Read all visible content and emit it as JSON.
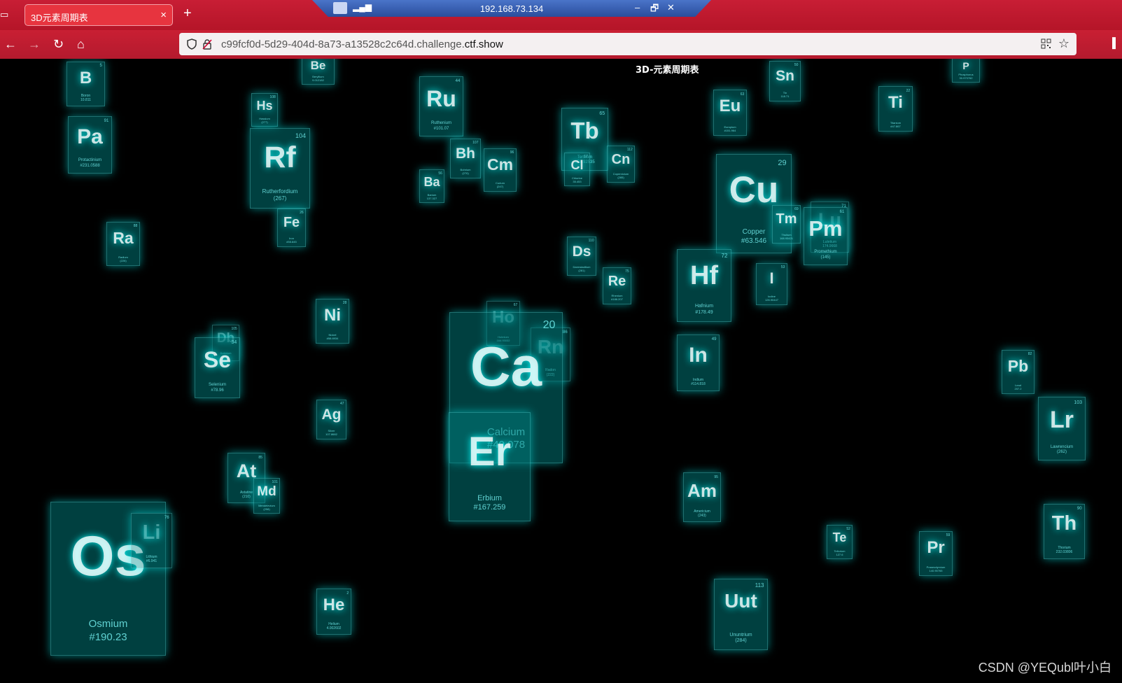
{
  "browser": {
    "tab_title": "3D元素周期表",
    "tab_close": "×",
    "new_tab": "+",
    "remote_title": "192.168.73.134",
    "remote_minimize": "–",
    "remote_restore": "🗗",
    "remote_close": "✕",
    "nav_back": "←",
    "nav_forward": "→",
    "nav_reload": "↻",
    "nav_home": "⌂",
    "url_prefix": "c99fcf0d-5d29-404d-8a73-a13528c2c64d.challenge.",
    "url_domain": "ctf.show",
    "star": "☆"
  },
  "page": {
    "title": "3D-元素周期表"
  },
  "elements": [
    {
      "id": "b",
      "symbol": "B",
      "number": "5",
      "name": "Boron",
      "weight": "10.811"
    },
    {
      "id": "be",
      "symbol": "Be",
      "number": "",
      "name": "Beryllium",
      "weight": "9.012182"
    },
    {
      "id": "p",
      "symbol": "P",
      "number": "",
      "name": "Phosphorus",
      "weight": "30.973762"
    },
    {
      "id": "hs",
      "symbol": "Hs",
      "number": "108",
      "name": "Hassium",
      "weight": "(277)"
    },
    {
      "id": "pa",
      "symbol": "Pa",
      "number": "91",
      "name": "Protactinium",
      "weight": "#231.0588"
    },
    {
      "id": "rf",
      "symbol": "Rf",
      "number": "104",
      "name": "Rutherfordium",
      "weight": "(267)"
    },
    {
      "id": "ru",
      "symbol": "Ru",
      "number": "44",
      "name": "Ruthenium",
      "weight": "#101.07"
    },
    {
      "id": "bh",
      "symbol": "Bh",
      "number": "107",
      "name": "Bohrium",
      "weight": "(270)"
    },
    {
      "id": "cm",
      "symbol": "Cm",
      "number": "96",
      "name": "Curium",
      "weight": "(247)"
    },
    {
      "id": "ba",
      "symbol": "Ba",
      "number": "56",
      "name": "Barium",
      "weight": "137.327"
    },
    {
      "id": "tb",
      "symbol": "Tb",
      "number": "65",
      "name": "Terbium",
      "weight": "158.92535"
    },
    {
      "id": "cl",
      "symbol": "Cl",
      "number": "17",
      "name": "Chlorine",
      "weight": "35.453"
    },
    {
      "id": "cn",
      "symbol": "Cn",
      "number": "112",
      "name": "Copernicium",
      "weight": "(285)"
    },
    {
      "id": "eu",
      "symbol": "Eu",
      "number": "63",
      "name": "Europium",
      "weight": "#151.964"
    },
    {
      "id": "sn",
      "symbol": "Sn",
      "number": "50",
      "name": "Tin",
      "weight": "118.71"
    },
    {
      "id": "ti",
      "symbol": "Ti",
      "number": "22",
      "name": "Titanium",
      "weight": "#47.867"
    },
    {
      "id": "fe",
      "symbol": "Fe",
      "number": "26",
      "name": "Iron",
      "weight": "#55.845"
    },
    {
      "id": "ra",
      "symbol": "Ra",
      "number": "88",
      "name": "Radium",
      "weight": "(226)"
    },
    {
      "id": "cu",
      "symbol": "Cu",
      "number": "29",
      "name": "Copper",
      "weight": "#63.546"
    },
    {
      "id": "lu",
      "symbol": "Lu",
      "number": "71",
      "name": "Lutetium",
      "weight": "174.9668"
    },
    {
      "id": "tm",
      "symbol": "Tm",
      "number": "69",
      "name": "Thulium",
      "weight": "168.93421"
    },
    {
      "id": "pm",
      "symbol": "Pm",
      "number": "61",
      "name": "Promethium",
      "weight": "(145)"
    },
    {
      "id": "ds",
      "symbol": "Ds",
      "number": "110",
      "name": "Darmstadtium",
      "weight": "(281)"
    },
    {
      "id": "re",
      "symbol": "Re",
      "number": "75",
      "name": "Rhenium",
      "weight": "#186.207"
    },
    {
      "id": "hf",
      "symbol": "Hf",
      "number": "72",
      "name": "Hafnium",
      "weight": "#178.49"
    },
    {
      "id": "i",
      "symbol": "I",
      "number": "53",
      "name": "Iodine",
      "weight": "126.90447"
    },
    {
      "id": "ni",
      "symbol": "Ni",
      "number": "28",
      "name": "Nickel",
      "weight": "#58.6934"
    },
    {
      "id": "db",
      "symbol": "Db",
      "number": "105",
      "name": "Dubnium",
      "weight": "(268)"
    },
    {
      "id": "se",
      "symbol": "Se",
      "number": "34",
      "name": "Selenium",
      "weight": "#78.96"
    },
    {
      "id": "ho",
      "symbol": "Ho",
      "number": "67",
      "name": "Holmium",
      "weight": "164.93032"
    },
    {
      "id": "rn",
      "symbol": "Rn",
      "number": "86",
      "name": "Radon",
      "weight": "(222)"
    },
    {
      "id": "ca",
      "symbol": "Ca",
      "number": "20",
      "name": "Calcium",
      "weight": "#40.078"
    },
    {
      "id": "er",
      "symbol": "Er",
      "number": "",
      "name": "Erbium",
      "weight": "#167.259"
    },
    {
      "id": "in",
      "symbol": "In",
      "number": "49",
      "name": "Indium",
      "weight": "#114.818"
    },
    {
      "id": "pb",
      "symbol": "Pb",
      "number": "82",
      "name": "Lead",
      "weight": "207.2"
    },
    {
      "id": "ag",
      "symbol": "Ag",
      "number": "47",
      "name": "Silver",
      "weight": "107.8682"
    },
    {
      "id": "lr",
      "symbol": "Lr",
      "number": "103",
      "name": "Lawrencium",
      "weight": "(262)"
    },
    {
      "id": "at",
      "symbol": "At",
      "number": "85",
      "name": "Astatine",
      "weight": "(210)"
    },
    {
      "id": "md",
      "symbol": "Md",
      "number": "101",
      "name": "Mendelevium",
      "weight": "(258)"
    },
    {
      "id": "am",
      "symbol": "Am",
      "number": "95",
      "name": "Americium",
      "weight": "(243)"
    },
    {
      "id": "os",
      "symbol": "Os",
      "number": "",
      "name": "Osmium",
      "weight": "#190.23"
    },
    {
      "id": "li",
      "symbol": "Li",
      "number": "76",
      "name": "Lithium",
      "weight": "#6.941"
    },
    {
      "id": "te",
      "symbol": "Te",
      "number": "52",
      "name": "Tellurium",
      "weight": "127.6"
    },
    {
      "id": "pr",
      "symbol": "Pr",
      "number": "59",
      "name": "Praseodymium",
      "weight": "140.90765"
    },
    {
      "id": "th",
      "symbol": "Th",
      "number": "90",
      "name": "Thorium",
      "weight": "232.03806"
    },
    {
      "id": "he",
      "symbol": "He",
      "number": "2",
      "name": "Helium",
      "weight": "4.002602"
    },
    {
      "id": "uut",
      "symbol": "Uut",
      "number": "113",
      "name": "Ununtrium",
      "weight": "(284)"
    }
  ],
  "watermark": "CSDN @YEQubl叶小白"
}
